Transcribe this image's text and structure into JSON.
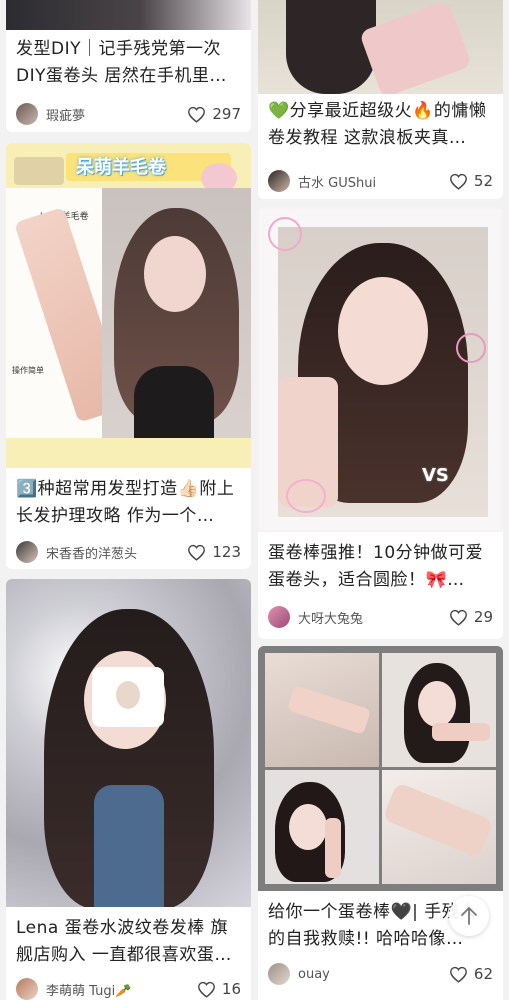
{
  "feed": {
    "left": [
      {
        "title": "发型DIY｜记手残党第一次DIY蛋卷头 居然在手机里…",
        "author": "瑕疵夢",
        "likes": "297"
      },
      {
        "banner": "呆萌羊毛卷",
        "product_label": "Lena羊毛卷",
        "side_note": "操作简单",
        "title": "3️⃣种超常用发型打造👍🏻附上长发护理攻略 作为一个…",
        "author": "宋香香的洋葱头",
        "likes": "123"
      },
      {
        "title": "Lena 蛋卷水波纹卷发棒 旗舰店购入 一直都很喜欢蛋…",
        "author": "李萌萌 Tugi🥕",
        "likes": "16"
      }
    ],
    "right": [
      {
        "title": "💚分享最近超级火🔥的慵懒卷发教程 这款浪板夹真…",
        "author": "古水 GUShui",
        "likes": "52"
      },
      {
        "vs_label": "VS",
        "title": "蛋卷棒强推！10分钟做可爱蛋卷头，适合圆脸！🎀…",
        "author": "大呀大兔兔",
        "likes": "29"
      },
      {
        "title": "给你一个蛋卷棒🖤| 手残人的自我救赎!! 哈哈哈像…",
        "author": "ouay",
        "likes": "62"
      }
    ]
  },
  "icons": {
    "like": "heart-outline-icon",
    "scroll_top": "arrow-up-icon"
  },
  "colors": {
    "background": "#f2f2f2",
    "card": "#ffffff",
    "text": "#222222",
    "meta_text": "#555555",
    "banner_bg": "#f7efb5",
    "banner_text": "#4aa8d8"
  }
}
